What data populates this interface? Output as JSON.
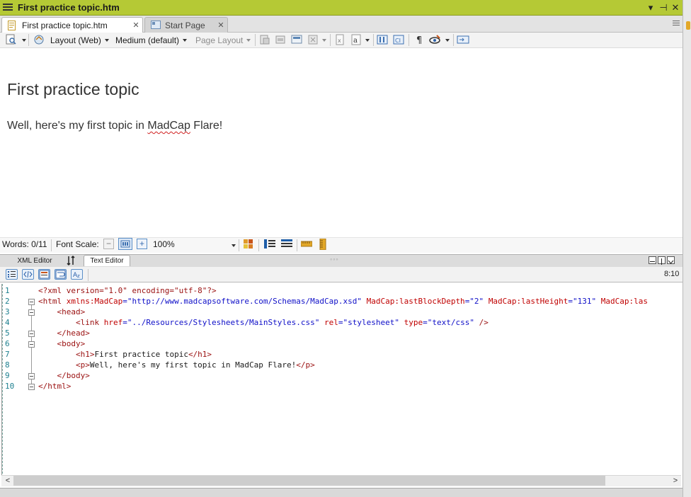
{
  "window": {
    "title": "First practice topic.htm",
    "controls": {
      "dropdown": "▾",
      "pin": "⊣",
      "close": "✕"
    }
  },
  "tabs": [
    {
      "label": "First practice topic.htm",
      "close": "✕",
      "active": true
    },
    {
      "label": "Start Page",
      "close": "✕",
      "active": false
    }
  ],
  "toolbar": {
    "layout": "Layout (Web)",
    "medium": "Medium (default)",
    "page_layout": "Page Layout"
  },
  "document": {
    "heading": "First practice topic",
    "para_before": "Well, here's my first topic in ",
    "para_misspelled": "MadCap",
    "para_after": " Flare!"
  },
  "statusbar": {
    "words": "Words: 0/11",
    "font_scale_label": "Font Scale:",
    "zoom": "100%"
  },
  "editor_tabs": {
    "xml": "XML Editor",
    "text": "Text Editor",
    "dots": "◦◦◦"
  },
  "editor": {
    "cursor_pos": "8:10",
    "line_numbers": [
      "1",
      "2",
      "3",
      "4",
      "5",
      "6",
      "7",
      "8",
      "9",
      "10"
    ],
    "lines": {
      "l1": "<?xml version=\"1.0\" encoding=\"utf-8\"?>",
      "l2_tag": "<html ",
      "l2_ns_attr": "xmlns:MadCap",
      "l2_ns_val": "=\"http://www.madcapsoftware.com/Schemas/MadCap.xsd\" ",
      "l2_attr2": "MadCap:lastBlockDepth",
      "l2_val2": "=\"2\" ",
      "l2_attr3": "MadCap:lastHeight",
      "l2_val3": "=\"131\" ",
      "l2_attr4": "MadCap:las",
      "l3": "    <head>",
      "l4_tag": "        <link ",
      "l4_a1": "href",
      "l4_v1": "=\"../Resources/Stylesheets/MainStyles.css\" ",
      "l4_a2": "rel",
      "l4_v2": "=\"stylesheet\" ",
      "l4_a3": "type",
      "l4_v3": "=\"text/css\" ",
      "l4_end": "/>",
      "l5": "    </head>",
      "l6": "    <body>",
      "l7_open": "        <h1>",
      "l7_text": "First practice topic",
      "l7_close": "</h1>",
      "l8_open": "        <p>",
      "l8_text": "Well, here's my first topic in MadCap Flare!",
      "l8_close": "</p>",
      "l9": "    </body>",
      "l10": "</html>"
    }
  },
  "scroll": {
    "left": "<",
    "right": ">"
  }
}
